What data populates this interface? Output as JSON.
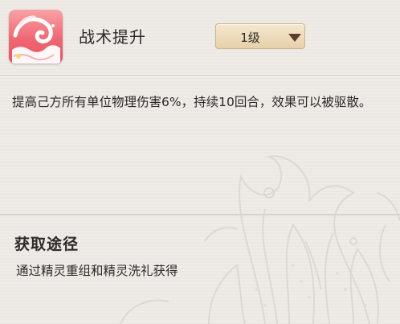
{
  "skill": {
    "name": "战术提升",
    "icon": "pink-swirl-wave-icon",
    "level": "1级",
    "description": "提高己方所有单位物理伤害6%，持续10回合，效果可以被驱散。"
  },
  "source": {
    "heading": "获取途径",
    "text": "通过精灵重组和精灵洗礼获得"
  },
  "colors": {
    "panel_bg": "#efebe7",
    "text": "#2c2927",
    "icon_pink": "#f0606e",
    "dropdown_bg": "#efdcba",
    "dropdown_arrow": "#5a3d2c"
  }
}
